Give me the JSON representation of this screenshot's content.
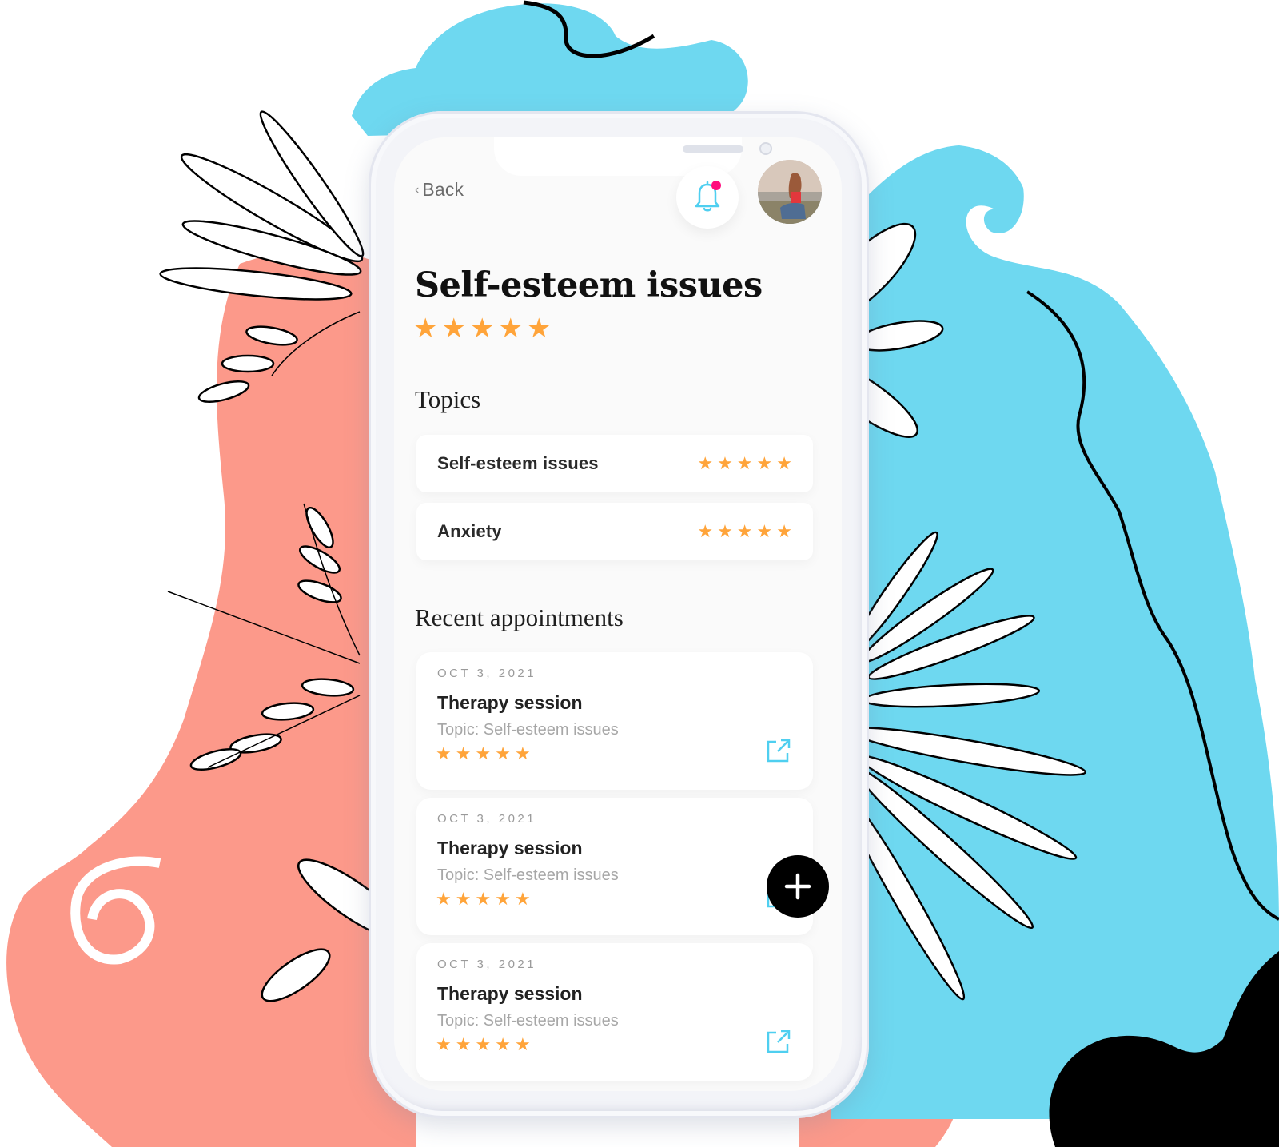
{
  "colors": {
    "coral": "#fc998a",
    "sky": "#6ed8f0",
    "star": "#ffa43a",
    "accent": "#4fcff0",
    "notification": "#ff0c7d"
  },
  "header": {
    "back_label": "Back",
    "has_notification": true
  },
  "page": {
    "title": "Self-esteem issues",
    "rating": 5,
    "rating_max": 5
  },
  "topics": {
    "heading": "Topics",
    "items": [
      {
        "name": "Self-esteem issues",
        "rating": 5
      },
      {
        "name": "Anxiety",
        "rating": 5
      }
    ]
  },
  "appointments": {
    "heading": "Recent appointments",
    "items": [
      {
        "date": "OCT 3, 2021",
        "title": "Therapy session",
        "topic": "Topic: Self-esteem issues",
        "rating": 5
      },
      {
        "date": "OCT 3, 2021",
        "title": "Therapy session",
        "topic": "Topic: Self-esteem issues",
        "rating": 5
      },
      {
        "date": "OCT 3, 2021",
        "title": "Therapy session",
        "topic": "Topic: Self-esteem issues",
        "rating": 5
      }
    ]
  },
  "icons": {
    "back": "chevron-left-icon",
    "bell": "bell-icon",
    "star": "★",
    "open": "external-link-icon",
    "add": "plus-icon"
  }
}
